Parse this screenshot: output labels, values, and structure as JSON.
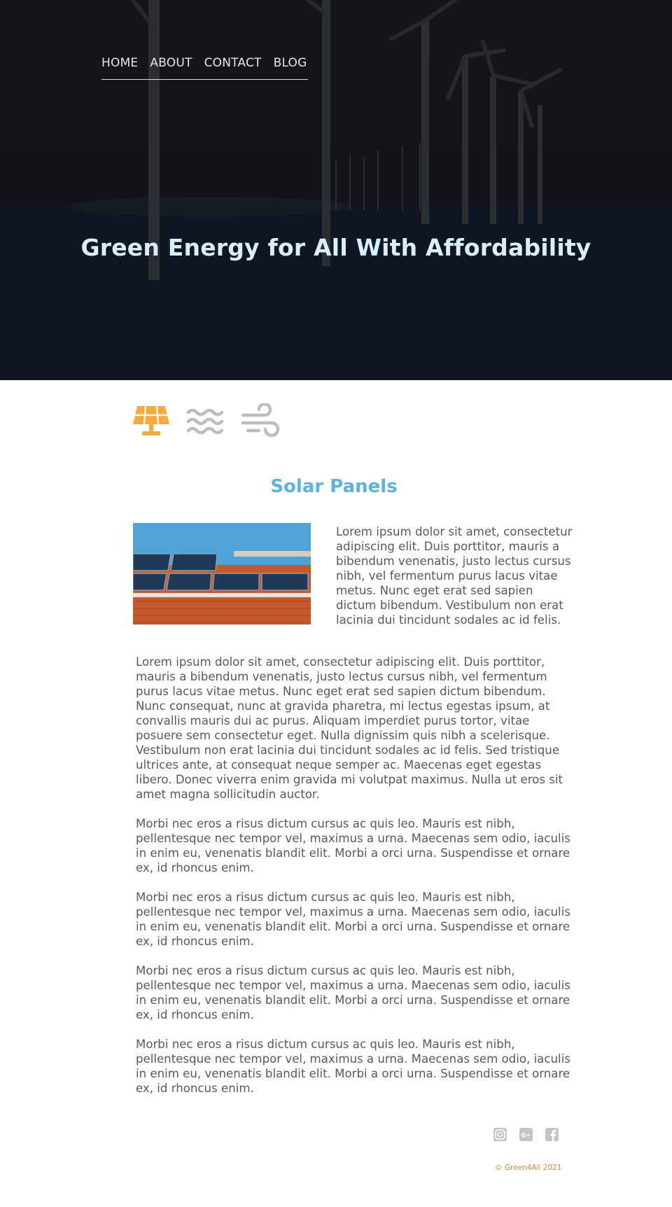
{
  "nav": {
    "items": [
      {
        "label": "HOME"
      },
      {
        "label": "ABOUT"
      },
      {
        "label": "CONTACT"
      },
      {
        "label": "BLOG"
      }
    ]
  },
  "hero": {
    "title": "Green Energy for All With Affordability"
  },
  "tabs": [
    {
      "icon": "solar-panel-icon",
      "active": true,
      "color": "#f2ac3d"
    },
    {
      "icon": "water-waves-icon",
      "active": false,
      "color": "#bdbdbd"
    },
    {
      "icon": "wind-icon",
      "active": false,
      "color": "#bdbdbd"
    }
  ],
  "section": {
    "title": "Solar Panels",
    "intro": "Lorem ipsum dolor sit amet, consectetur adipiscing elit. Duis porttitor, mauris a bibendum venenatis, justo lectus cursus nibh, vel fermentum purus lacus vitae metus. Nunc eget erat sed sapien dictum bibendum. Vestibulum non erat lacinia dui tincidunt sodales ac id felis.",
    "paragraphs": [
      "Lorem ipsum dolor sit amet, consectetur adipiscing elit. Duis porttitor, mauris a bibendum venenatis, justo lectus cursus nibh, vel fermentum purus lacus vitae metus. Nunc eget erat sed sapien dictum bibendum. Nunc consequat, nunc at gravida pharetra, mi lectus egestas ipsum, at convallis mauris dui ac purus. Aliquam imperdiet purus tortor, vitae posuere sem consectetur eget. Nulla dignissim quis nibh a scelerisque. Vestibulum non erat lacinia dui tincidunt sodales ac id felis. Sed tristique ultrices ante, at consequat neque semper ac. Maecenas eget egestas libero. Donec viverra enim gravida mi volutpat maximus. Nulla ut eros sit amet magna sollicitudin auctor.",
      "Morbi nec eros a risus dictum cursus ac quis leo. Mauris est nibh, pellentesque nec tempor vel, maximus a urna. Maecenas sem odio, iaculis in enim eu, venenatis blandit elit. Morbi a orci urna. Suspendisse et ornare ex, id rhoncus enim.",
      "Morbi nec eros a risus dictum cursus ac quis leo. Mauris est nibh, pellentesque nec tempor vel, maximus a urna. Maecenas sem odio, iaculis in enim eu, venenatis blandit elit. Morbi a orci urna. Suspendisse et ornare ex, id rhoncus enim.",
      "Morbi nec eros a risus dictum cursus ac quis leo. Mauris est nibh, pellentesque nec tempor vel, maximus a urna. Maecenas sem odio, iaculis in enim eu, venenatis blandit elit. Morbi a orci urna. Suspendisse et ornare ex, id rhoncus enim.",
      "Morbi nec eros a risus dictum cursus ac quis leo. Mauris est nibh, pellentesque nec tempor vel, maximus a urna. Maecenas sem odio, iaculis in enim eu, venenatis blandit elit. Morbi a orci urna. Suspendisse et ornare ex, id rhoncus enim."
    ]
  },
  "footer": {
    "social": [
      {
        "icon": "instagram-icon"
      },
      {
        "icon": "google-plus-icon"
      },
      {
        "icon": "facebook-icon"
      }
    ],
    "copyright": "© Green4All 2021"
  },
  "colors": {
    "accent_blue": "#5bb3e2",
    "accent_orange": "#f2ac3d",
    "hero_title": "#d9eefb",
    "copyright": "#d08a3a"
  }
}
